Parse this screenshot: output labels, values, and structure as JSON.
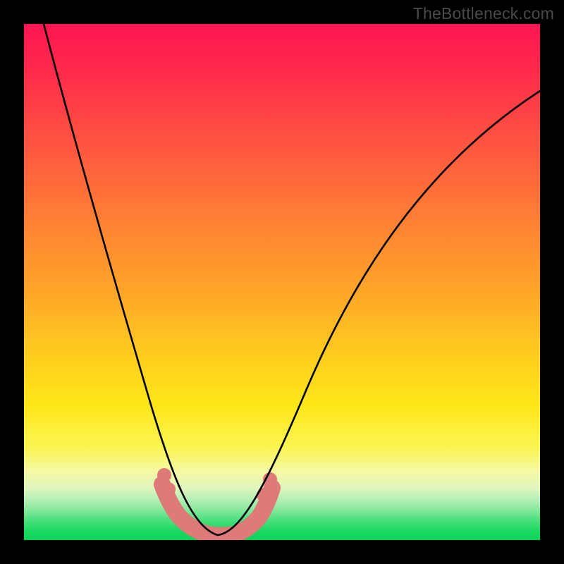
{
  "watermark": "TheBottleneck.com",
  "chart_data": {
    "type": "line",
    "title": "",
    "xlabel": "",
    "ylabel": "",
    "xlim": [
      0,
      100
    ],
    "ylim": [
      0,
      100
    ],
    "series": [
      {
        "name": "curve",
        "x": [
          4,
          6,
          8,
          10,
          12,
          14,
          16,
          18,
          20,
          22,
          24,
          26,
          28,
          30,
          32,
          34,
          36,
          38,
          40,
          44,
          48,
          52,
          56,
          60,
          64,
          68,
          72,
          76,
          80,
          84,
          88,
          92,
          96,
          100
        ],
        "values": [
          100,
          92,
          84,
          77,
          70,
          63,
          56,
          50,
          44,
          38,
          32,
          26,
          21,
          16,
          11,
          7,
          4,
          2,
          1,
          2,
          6,
          12,
          19,
          27,
          35,
          43,
          50,
          57,
          63,
          69,
          74,
          79,
          83,
          87
        ]
      },
      {
        "name": "bottom-band",
        "x": [
          27,
          28.5,
          30,
          32,
          34,
          36,
          38,
          40,
          42,
          44,
          46,
          47.5
        ],
        "values": [
          11,
          8.5,
          6,
          4,
          2.5,
          1.7,
          1.3,
          1.6,
          2.8,
          5,
          8,
          11
        ]
      }
    ],
    "colors": {
      "curve": "#000000",
      "band": "#de7a77",
      "gradient_top": "#ff1552",
      "gradient_mid": "#ffcc1e",
      "gradient_bottom": "#07d557"
    }
  }
}
